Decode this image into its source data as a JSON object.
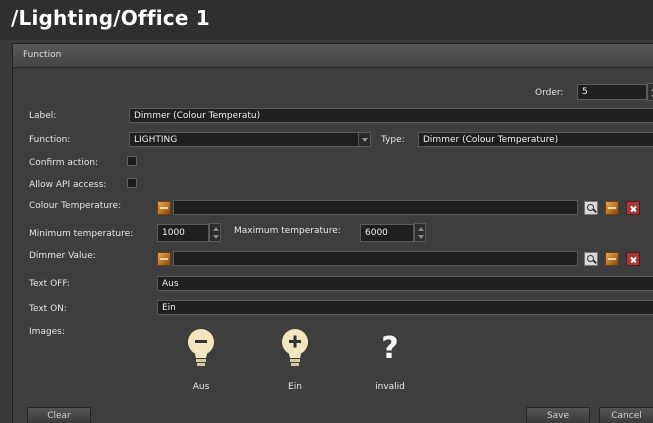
{
  "page": {
    "title": "/Lighting/Office 1"
  },
  "panel": {
    "header": "Function"
  },
  "form": {
    "order_label": "Order:",
    "order_value": "5",
    "label_label": "Label:",
    "label_value": "Dimmer (Colour Temperatu)",
    "function_label": "Function:",
    "function_value": "LIGHTING",
    "type_label": "Type:",
    "type_value": "Dimmer (Colour Temperature)",
    "confirm_label": "Confirm action:",
    "confirm_checked": false,
    "api_label": "Allow API access:",
    "api_checked": false,
    "colour_temp_label": "Colour Temperature:",
    "colour_temp_value": "",
    "min_temp_label": "Minimum temperature:",
    "min_temp_value": "1000",
    "max_temp_label": "Maximum temperature:",
    "max_temp_value": "6000",
    "dimmer_label": "Dimmer Value:",
    "dimmer_value": "",
    "text_off_label": "Text OFF:",
    "text_off_value": "Aus",
    "text_on_label": "Text ON:",
    "text_on_value": "Ein",
    "images_label": "Images:"
  },
  "images": [
    {
      "label": "Aus",
      "icon": "bulb-off-icon"
    },
    {
      "label": "Ein",
      "icon": "bulb-on-icon"
    },
    {
      "label": "invalid",
      "icon": "question-mark-icon"
    }
  ],
  "buttons": {
    "clear": "Clear",
    "save": "Save",
    "cancel": "Cancel"
  },
  "colors": {
    "background": "#3a3a3a",
    "field": "#1f1f1f",
    "text": "#e6e6e6"
  }
}
